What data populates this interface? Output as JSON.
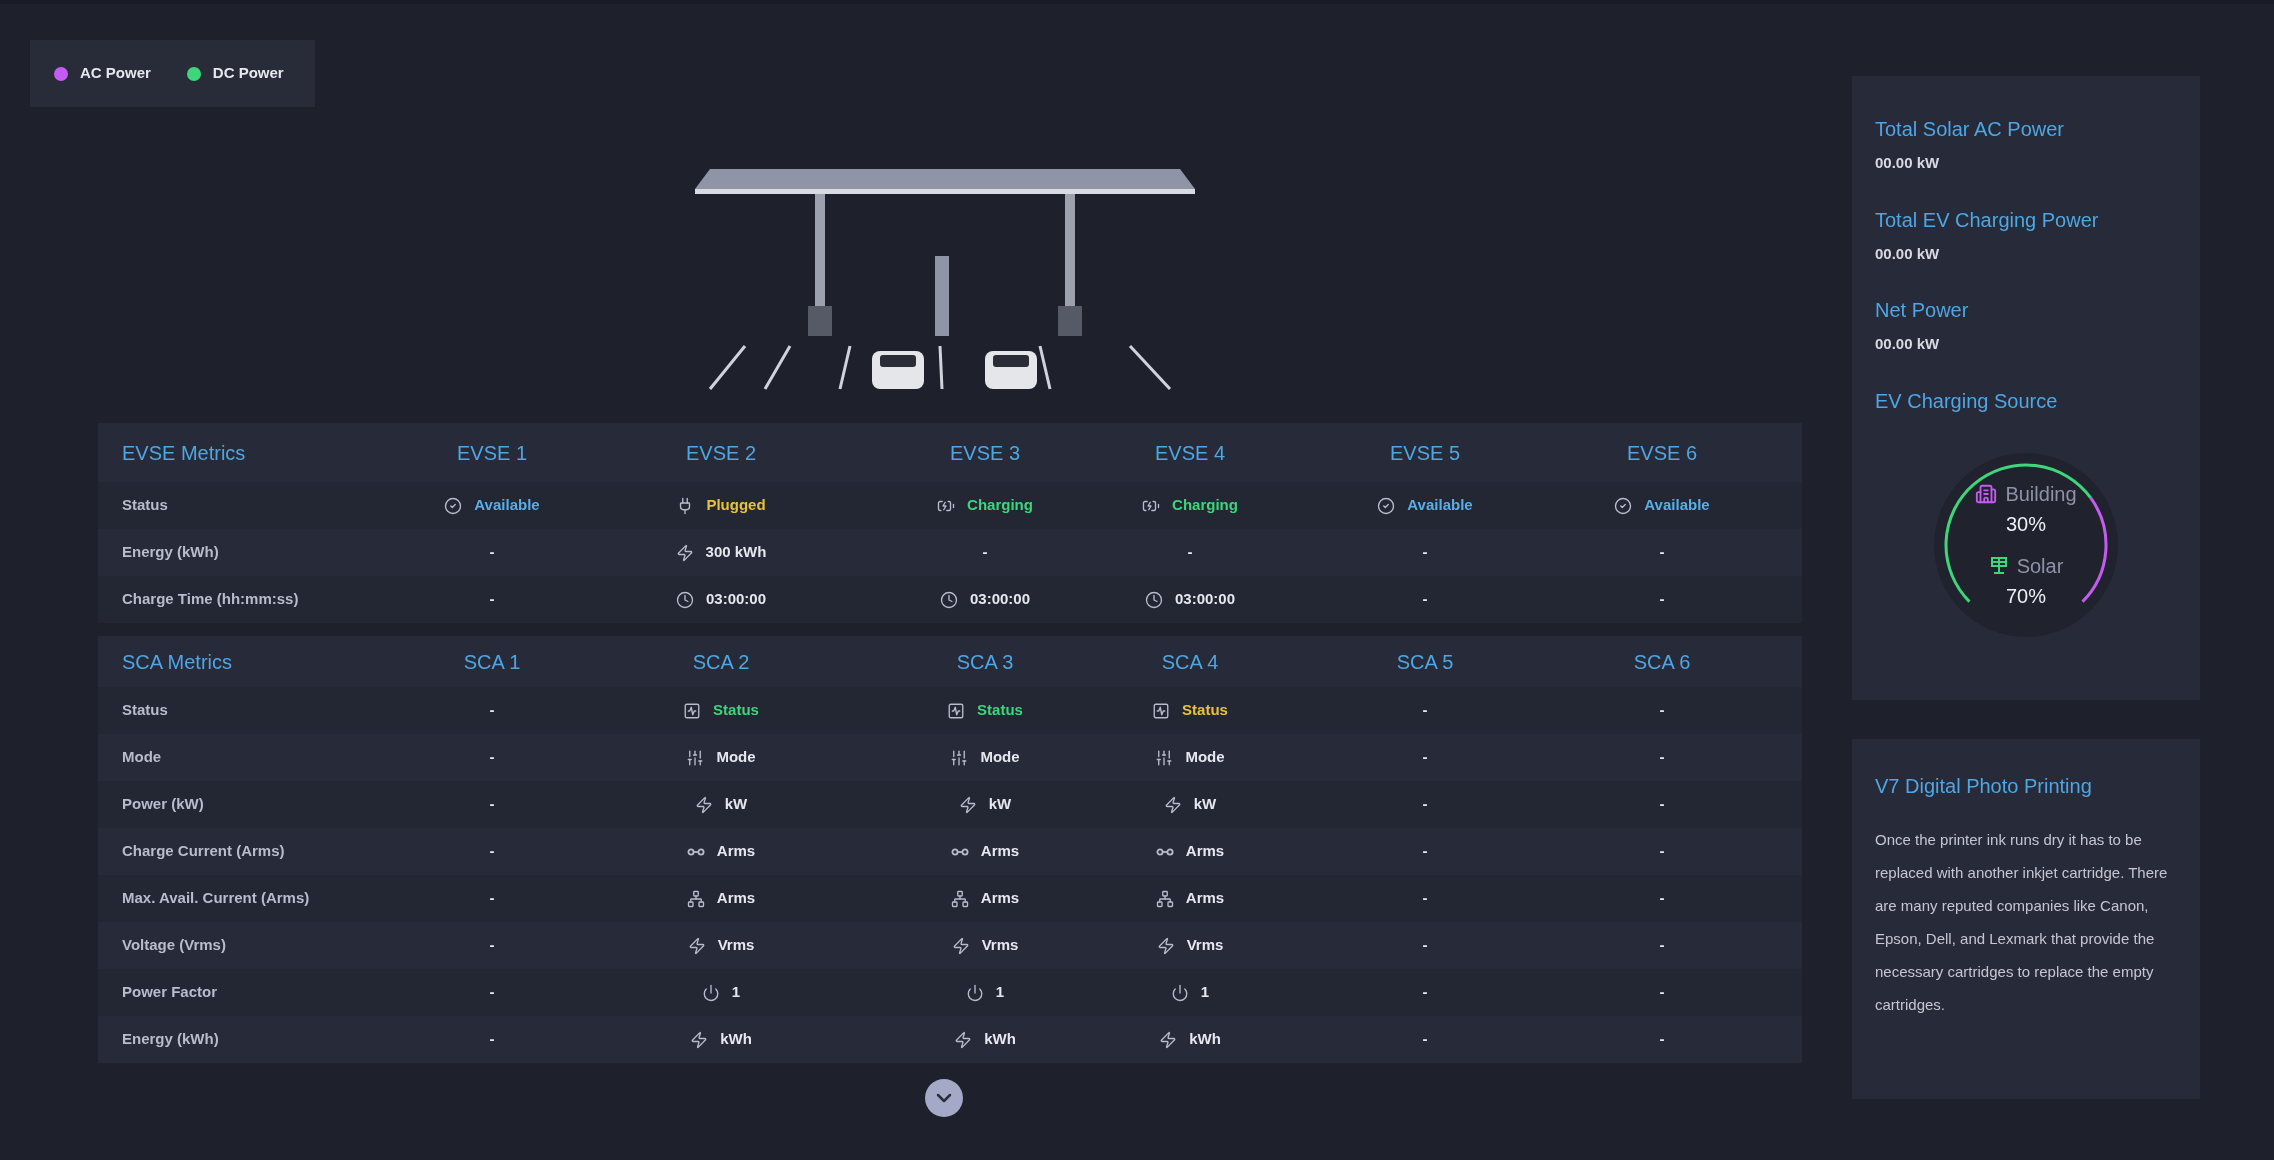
{
  "legend": [
    {
      "label": "AC Power",
      "color": "#c45cf2"
    },
    {
      "label": "DC Power",
      "color": "#3ed67a"
    }
  ],
  "evse_table": {
    "title": "EVSE Metrics",
    "columns": [
      {
        "label": "EVSE 1"
      },
      {
        "label": "EVSE 2"
      },
      {
        "label": "EVSE 3"
      },
      {
        "label": "EVSE 4"
      },
      {
        "label": "EVSE 5"
      },
      {
        "label": "EVSE 6"
      }
    ],
    "rows": [
      {
        "label": "Status",
        "cells": [
          {
            "kind": "check",
            "text": "Available",
            "color": "#5aaee8"
          },
          {
            "kind": "plug",
            "text": "Plugged",
            "color": "#e8c23e"
          },
          {
            "kind": "charging",
            "text": "Charging",
            "color": "#3ed67a"
          },
          {
            "kind": "charging",
            "text": "Charging",
            "color": "#3ed67a"
          },
          {
            "kind": "check",
            "text": "Available",
            "color": "#5aaee8"
          },
          {
            "kind": "check",
            "text": "Available",
            "color": "#5aaee8"
          }
        ]
      },
      {
        "label": "Energy (kWh)",
        "cells": [
          {
            "text": "-"
          },
          {
            "kind": "bolt",
            "text": "300 kWh"
          },
          {
            "text": "-"
          },
          {
            "text": "-"
          },
          {
            "text": "-"
          },
          {
            "text": "-"
          }
        ]
      },
      {
        "label": "Charge Time (hh:mm:ss)",
        "cells": [
          {
            "text": "-"
          },
          {
            "kind": "clock",
            "text": "03:00:00"
          },
          {
            "kind": "clock",
            "text": "03:00:00"
          },
          {
            "kind": "clock",
            "text": "03:00:00"
          },
          {
            "text": "-"
          },
          {
            "text": "-"
          }
        ]
      }
    ]
  },
  "sca_table": {
    "title": "SCA Metrics",
    "columns": [
      {
        "label": "SCA 1"
      },
      {
        "label": "SCA 2"
      },
      {
        "label": "SCA 3"
      },
      {
        "label": "SCA 4"
      },
      {
        "label": "SCA 5"
      },
      {
        "label": "SCA 6"
      }
    ],
    "rows": [
      {
        "label": "Status",
        "cells": [
          {
            "text": "-"
          },
          {
            "kind": "activity",
            "text": "Status",
            "color": "#3ed67a"
          },
          {
            "kind": "activity",
            "text": "Status",
            "color": "#3ed67a"
          },
          {
            "kind": "activity",
            "text": "Status",
            "color": "#e8c23e"
          },
          {
            "text": "-"
          },
          {
            "text": "-"
          }
        ]
      },
      {
        "label": "Mode",
        "cells": [
          {
            "text": "-"
          },
          {
            "kind": "sliders",
            "text": "Mode"
          },
          {
            "kind": "sliders",
            "text": "Mode"
          },
          {
            "kind": "sliders",
            "text": "Mode"
          },
          {
            "text": "-"
          },
          {
            "text": "-"
          }
        ]
      },
      {
        "label": "Power (kW)",
        "cells": [
          {
            "text": "-"
          },
          {
            "kind": "bolt",
            "text": "kW"
          },
          {
            "kind": "bolt",
            "text": "kW"
          },
          {
            "kind": "bolt",
            "text": "kW"
          },
          {
            "text": "-"
          },
          {
            "text": "-"
          }
        ]
      },
      {
        "label": "Charge Current (Arms)",
        "cells": [
          {
            "text": "-"
          },
          {
            "kind": "link",
            "text": "Arms"
          },
          {
            "kind": "link",
            "text": "Arms"
          },
          {
            "kind": "link",
            "text": "Arms"
          },
          {
            "text": "-"
          },
          {
            "text": "-"
          }
        ]
      },
      {
        "label": "Max. Avail. Current (Arms)",
        "cells": [
          {
            "text": "-"
          },
          {
            "kind": "network",
            "text": "Arms"
          },
          {
            "kind": "network",
            "text": "Arms"
          },
          {
            "kind": "network",
            "text": "Arms"
          },
          {
            "text": "-"
          },
          {
            "text": "-"
          }
        ]
      },
      {
        "label": "Voltage (Vrms)",
        "cells": [
          {
            "text": "-"
          },
          {
            "kind": "bolt",
            "text": "Vrms"
          },
          {
            "kind": "bolt",
            "text": "Vrms"
          },
          {
            "kind": "bolt",
            "text": "Vrms"
          },
          {
            "text": "-"
          },
          {
            "text": "-"
          }
        ]
      },
      {
        "label": "Power Factor",
        "cells": [
          {
            "text": "-"
          },
          {
            "kind": "power",
            "text": "1"
          },
          {
            "kind": "power",
            "text": "1"
          },
          {
            "kind": "power",
            "text": "1"
          },
          {
            "text": "-"
          },
          {
            "text": "-"
          }
        ]
      },
      {
        "label": "Energy (kWh)",
        "cells": [
          {
            "text": "-"
          },
          {
            "kind": "bolt",
            "text": "kWh"
          },
          {
            "kind": "bolt",
            "text": "kWh"
          },
          {
            "kind": "bolt",
            "text": "kWh"
          },
          {
            "text": "-"
          },
          {
            "text": "-"
          }
        ]
      }
    ]
  },
  "summary_panel": {
    "metrics": [
      {
        "title": "Total Solar AC Power",
        "value": "00.00 kW"
      },
      {
        "title": "Total EV Charging Power",
        "value": "00.00 kW"
      },
      {
        "title": "Net Power",
        "value": "00.00 kW"
      }
    ],
    "source_title": "EV Charging Source",
    "sources": [
      {
        "kind": "building",
        "label": "Building",
        "value": "30%",
        "color": "#c45cf2"
      },
      {
        "kind": "solar",
        "label": "Solar",
        "value": "70%",
        "color": "#3ed67a"
      }
    ]
  },
  "info_card": {
    "title": "V7 Digital Photo Printing",
    "body": "Once the printer ink runs dry it has to be replaced with another inkjet cartridge. There are many reputed companies like Canon, Epson, Dell, and Lexmark that provide the necessary cartridges to replace the empty cartridges."
  }
}
